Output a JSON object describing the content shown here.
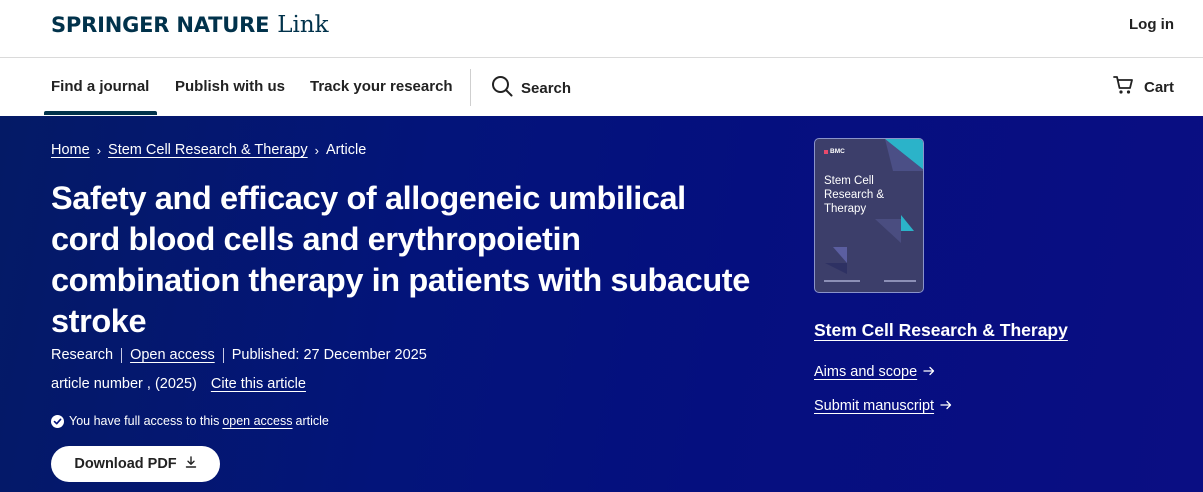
{
  "header": {
    "logo_main": "SPRINGER NATURE",
    "logo_link": "Link",
    "login_label": "Log in"
  },
  "nav": {
    "items": [
      {
        "label": "Find a journal",
        "active": true
      },
      {
        "label": "Publish with us",
        "active": false
      },
      {
        "label": "Track your research",
        "active": false
      }
    ],
    "search_label": "Search",
    "cart_label": "Cart",
    "search_icon": "search-icon",
    "cart_icon": "cart-icon"
  },
  "breadcrumb": {
    "home": "Home",
    "journal": "Stem Cell Research & Therapy",
    "current": "Article"
  },
  "article": {
    "title": "Safety and efficacy of allogeneic umbilical cord blood cells and erythropoietin combination therapy in patients with subacute stroke",
    "type": "Research",
    "access": "Open access",
    "published": "Published: 27 December 2025",
    "article_number": "article number , (2025)",
    "cite_label": "Cite this article",
    "access_notice_before": "You have full access to this",
    "access_notice_link": "open access",
    "access_notice_after": "article",
    "download_label": "Download PDF"
  },
  "journal": {
    "cover_publisher": "BMC",
    "cover_title": "Stem Cell Research & Therapy",
    "name": "Stem Cell Research & Therapy",
    "aims_label": "Aims and scope",
    "submit_label": "Submit manuscript"
  },
  "colors": {
    "brand_dark": "#01324b",
    "hero_bg": "#04127a",
    "cover_bg": "#3c3e6a",
    "cover_accent": "#2bb3c9"
  }
}
